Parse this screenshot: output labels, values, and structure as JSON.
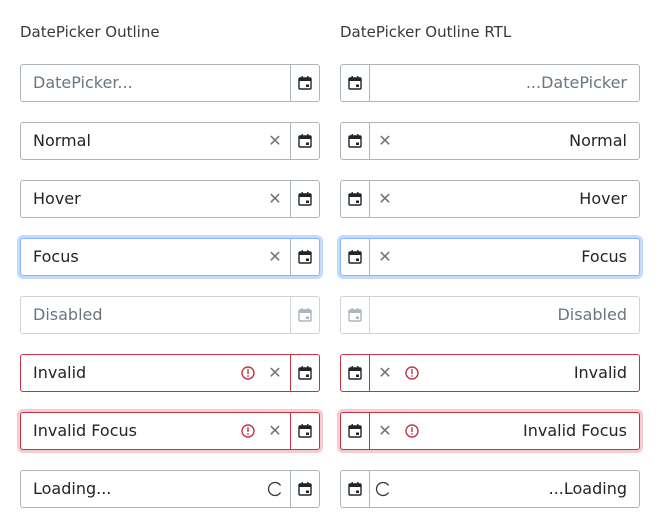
{
  "columns": [
    {
      "title": "DatePicker Outline",
      "fields": [
        {
          "text": "DatePicker...",
          "state": "placeholder"
        },
        {
          "text": "Normal",
          "state": "normal"
        },
        {
          "text": "Hover",
          "state": "hover"
        },
        {
          "text": "Focus",
          "state": "focus"
        },
        {
          "text": "Disabled",
          "state": "disabled"
        },
        {
          "text": "Invalid",
          "state": "invalid"
        },
        {
          "text": "Invalid Focus",
          "state": "invalid-focus"
        },
        {
          "text": "Loading...",
          "state": "loading"
        }
      ]
    },
    {
      "title": "DatePicker Outline RTL",
      "fields": [
        {
          "text": "...DatePicker",
          "state": "placeholder"
        },
        {
          "text": "Normal",
          "state": "normal"
        },
        {
          "text": "Hover",
          "state": "hover"
        },
        {
          "text": "Focus",
          "state": "focus"
        },
        {
          "text": "Disabled",
          "state": "disabled"
        },
        {
          "text": "Invalid",
          "state": "invalid"
        },
        {
          "text": "Invalid Focus",
          "state": "invalid-focus"
        },
        {
          "text": "...Loading",
          "state": "loading"
        }
      ]
    }
  ],
  "icons": {
    "calendar": "calendar-icon",
    "clear": "✕",
    "error": "error-circle-icon",
    "loading": "loading-spinner-icon"
  },
  "colors": {
    "border": "#adb5bd",
    "invalid": "#c33346",
    "focus_ring": "#86b7fe",
    "icon": "#6c757d"
  }
}
